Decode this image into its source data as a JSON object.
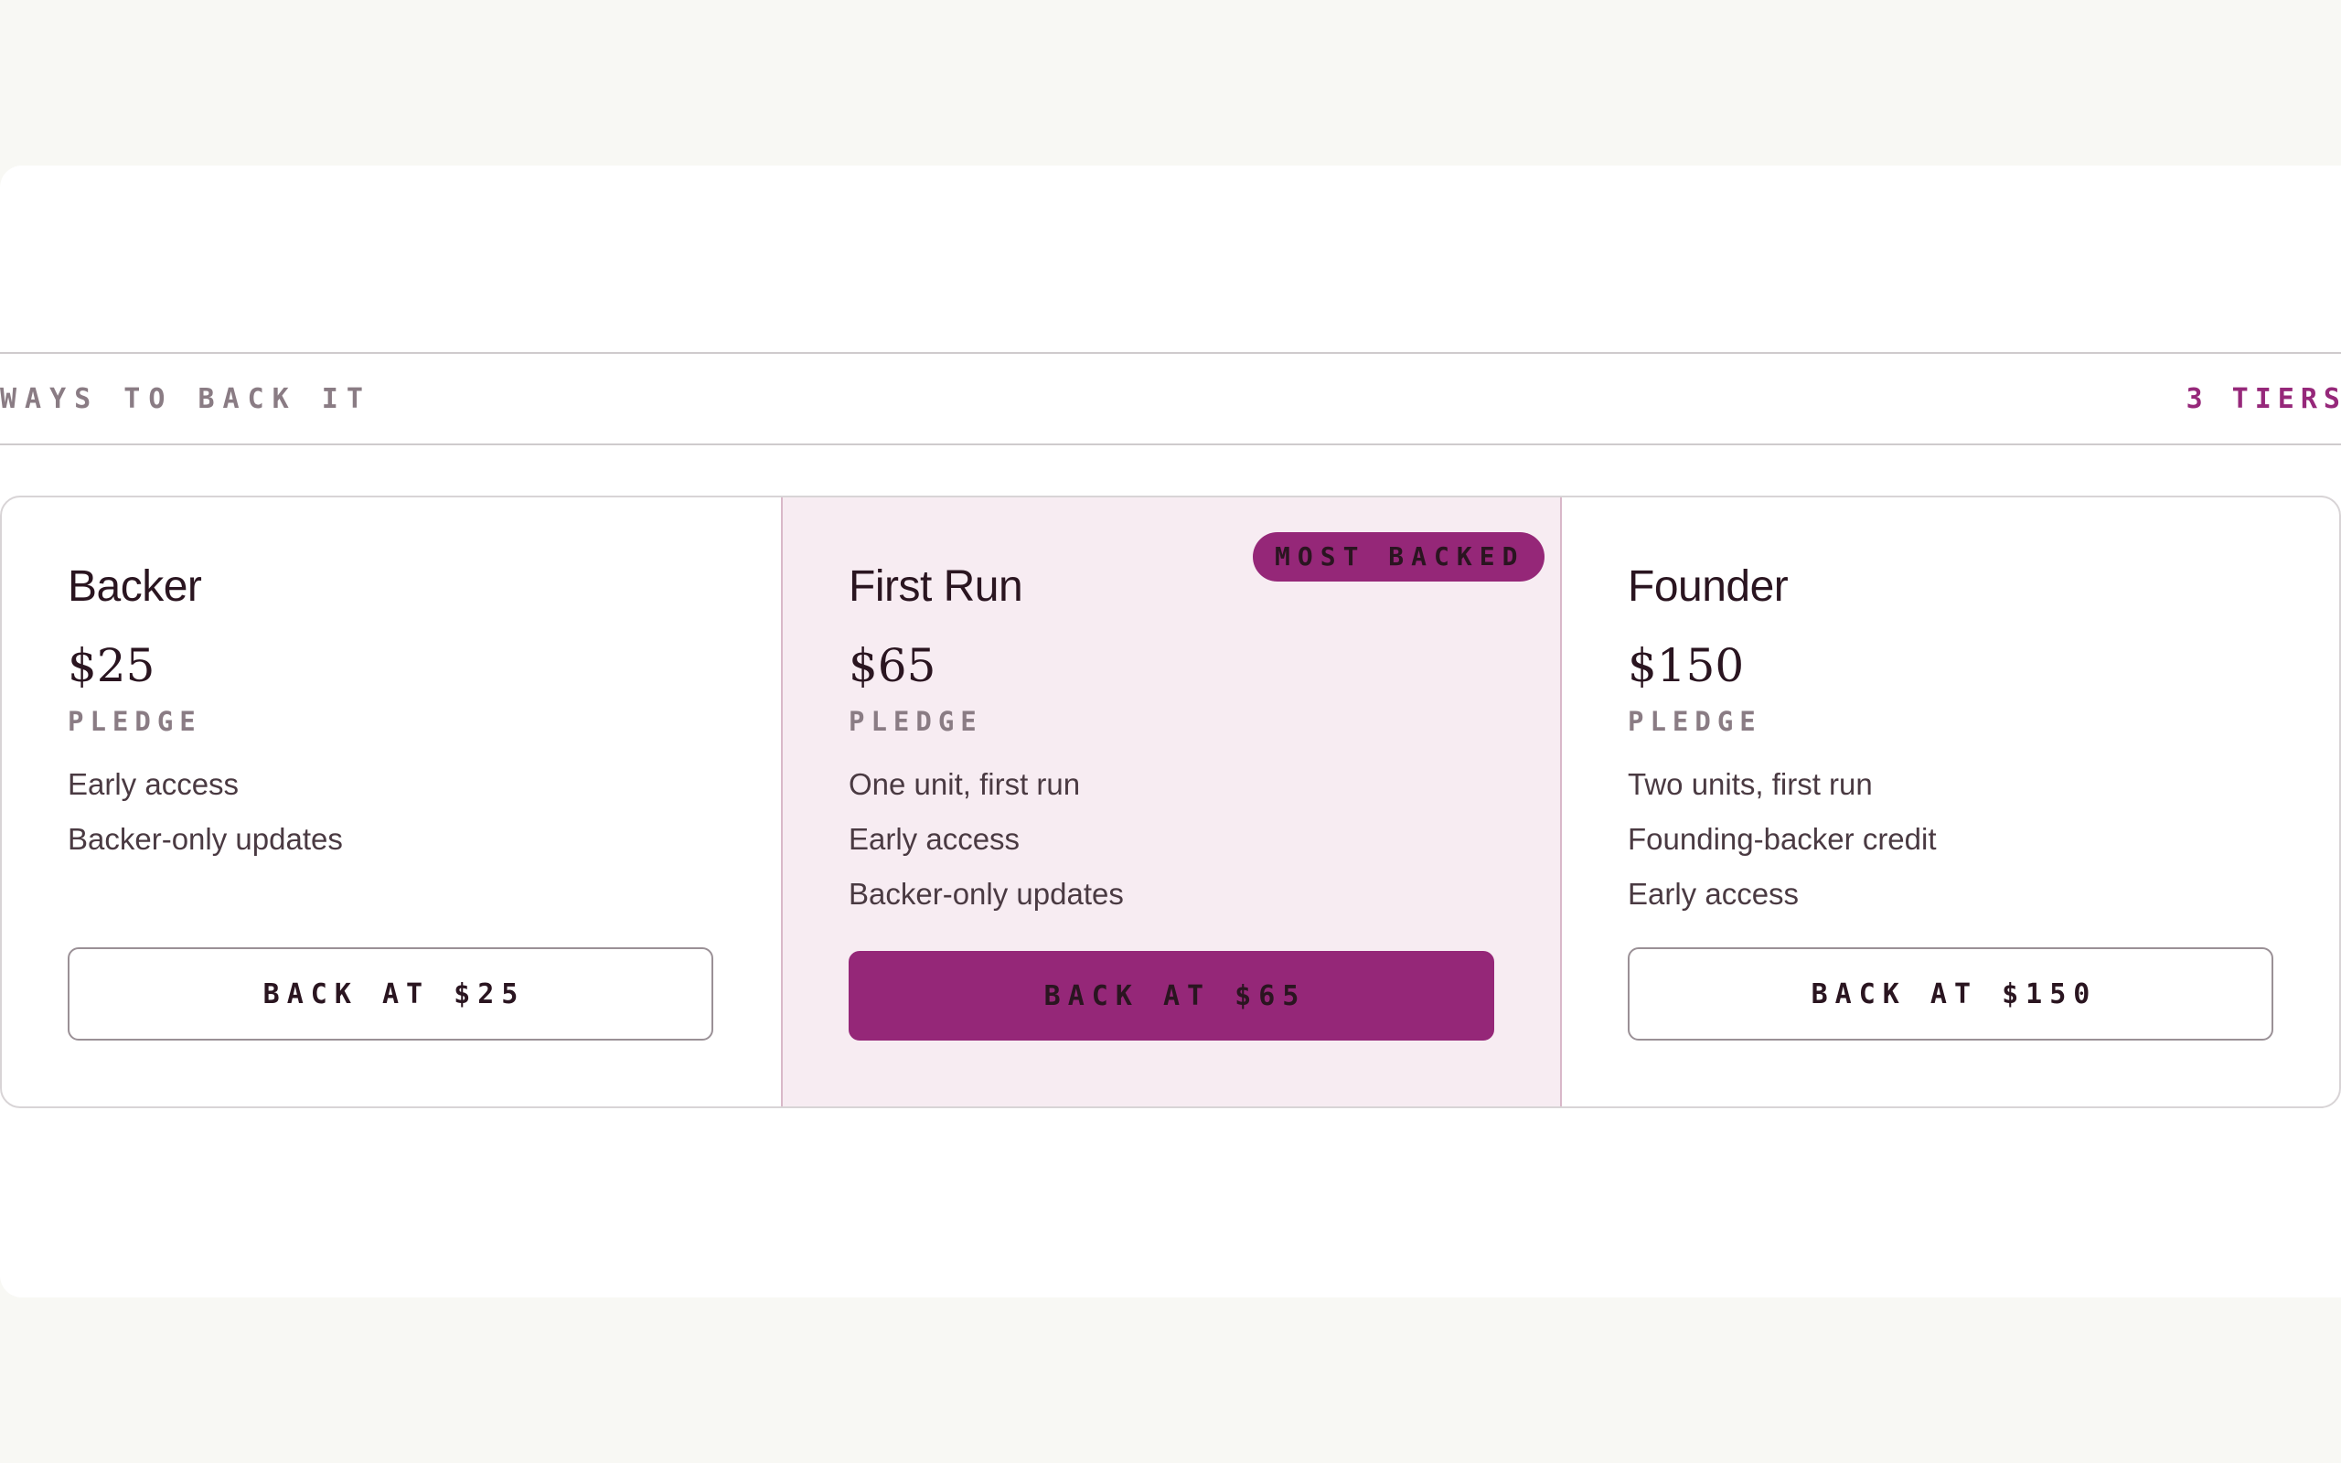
{
  "section": {
    "title": "WAYS TO BACK IT",
    "count_label": "3 TIERS"
  },
  "tiers": [
    {
      "name": "Backer",
      "price": "$25",
      "unit": "PLEDGE",
      "features": [
        "Early access",
        "Backer-only updates"
      ],
      "cta": "BACK AT $25"
    },
    {
      "name": "First Run",
      "price": "$65",
      "unit": "PLEDGE",
      "badge": "MOST BACKED",
      "features": [
        "One unit, first run",
        "Early access",
        "Backer-only updates"
      ],
      "cta": "BACK AT $65"
    },
    {
      "name": "Founder",
      "price": "$150",
      "unit": "PLEDGE",
      "features": [
        "Two units, first run",
        "Founding-backer credit",
        "Early access"
      ],
      "cta": "BACK AT $150"
    }
  ],
  "colors": {
    "accent": "#952778",
    "featured_bg": "#f7ecf2",
    "text": "#2a1520",
    "muted": "#8a7c84",
    "page_bg": "#f8f8f4"
  }
}
